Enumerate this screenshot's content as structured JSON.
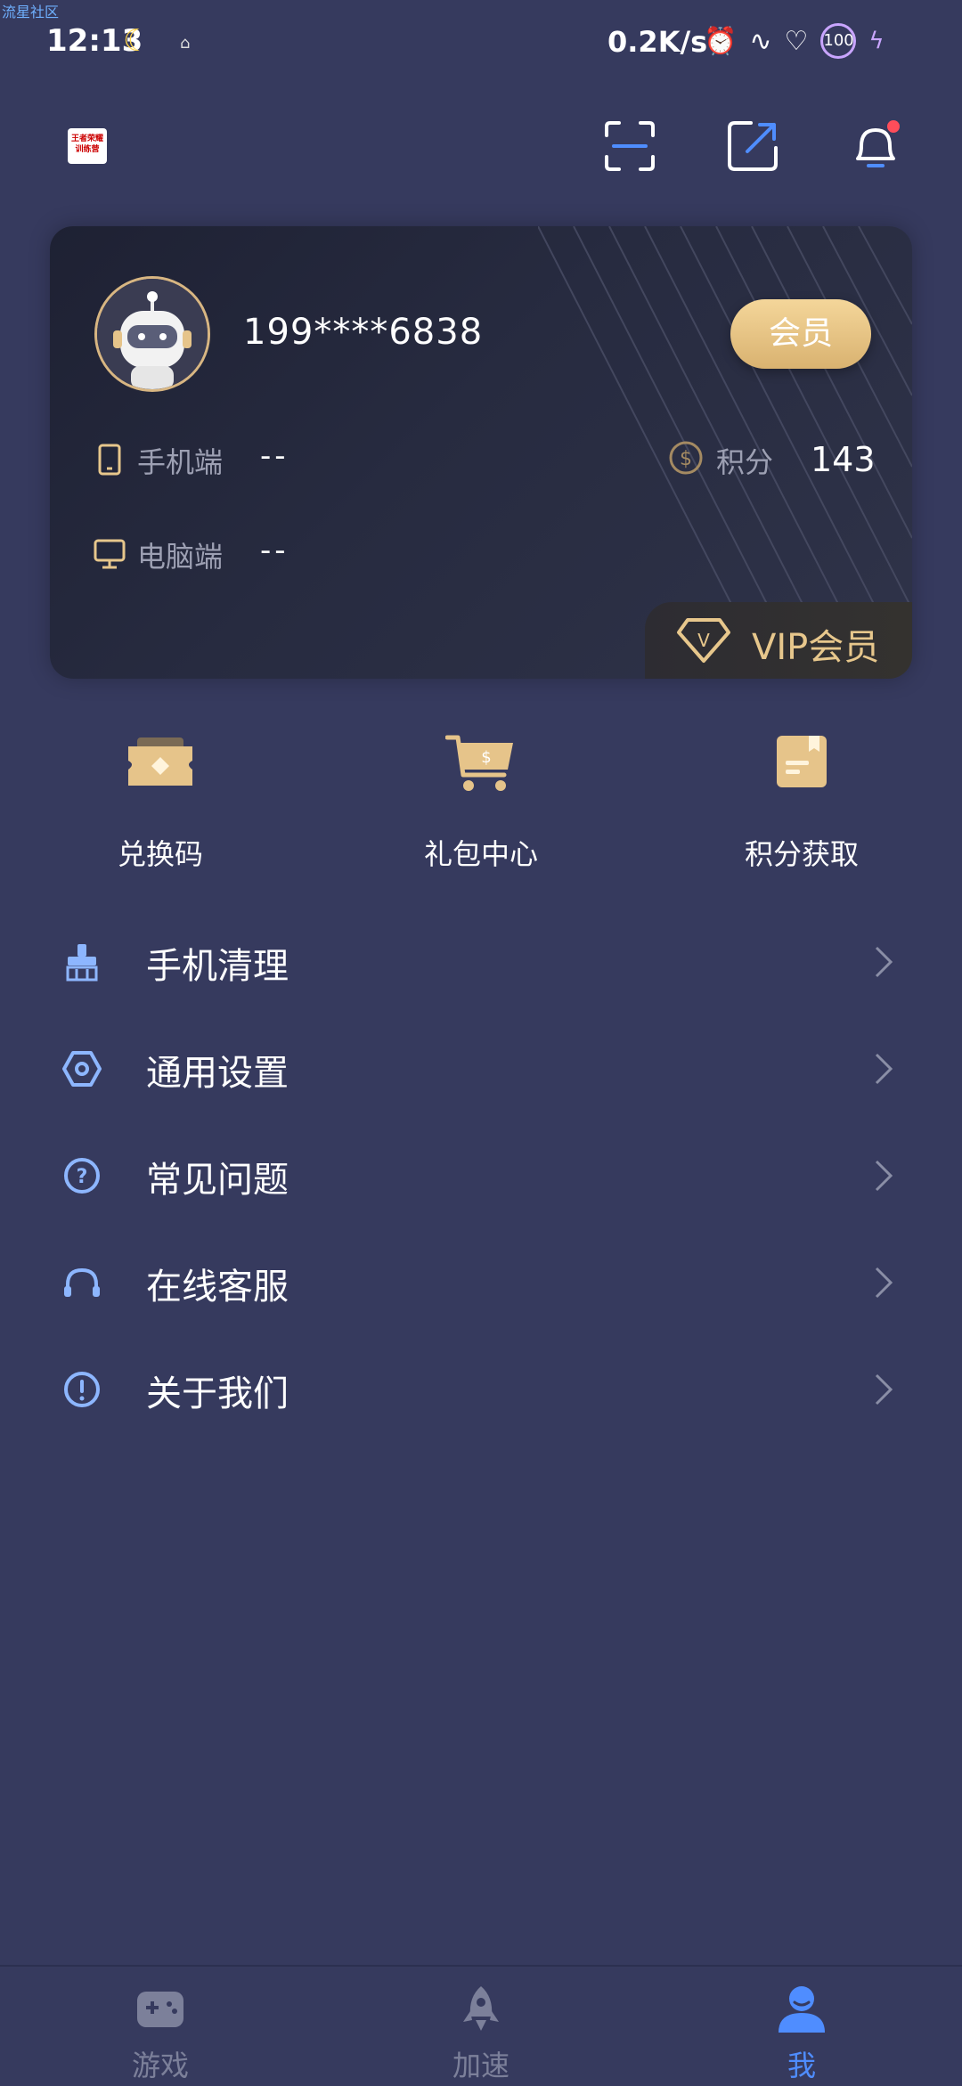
{
  "watermark": "流星社区",
  "status_bar": {
    "time": "12:13",
    "net_speed": "0.2K/s",
    "battery": "100"
  },
  "header": {
    "logo_text": "王者荣耀训练营"
  },
  "user_card": {
    "phone": "199****6838",
    "member_button": "会员",
    "mobile_label": "手机端",
    "mobile_value": "--",
    "pc_label": "电脑端",
    "pc_value": "--",
    "points_label": "积分",
    "points_value": "143",
    "vip_label": "VIP会员"
  },
  "quick_actions": [
    {
      "label": "兑换码",
      "icon": "ticket-icon"
    },
    {
      "label": "礼包中心",
      "icon": "cart-icon"
    },
    {
      "label": "积分获取",
      "icon": "note-icon"
    }
  ],
  "menu": [
    {
      "label": "手机清理",
      "icon": "broom-icon"
    },
    {
      "label": "通用设置",
      "icon": "settings-hex-icon"
    },
    {
      "label": "常见问题",
      "icon": "question-icon"
    },
    {
      "label": "在线客服",
      "icon": "headset-icon"
    },
    {
      "label": "关于我们",
      "icon": "info-icon"
    }
  ],
  "bottom_nav": [
    {
      "label": "游戏",
      "icon": "gamepad-icon",
      "active": false
    },
    {
      "label": "加速",
      "icon": "rocket-icon",
      "active": false
    },
    {
      "label": "我",
      "icon": "person-icon",
      "active": true
    }
  ],
  "colors": {
    "background": "#363a5e",
    "gold": "#e7c78c",
    "accent_blue": "#4f8dff",
    "icon_blue": "#8db6ff"
  }
}
